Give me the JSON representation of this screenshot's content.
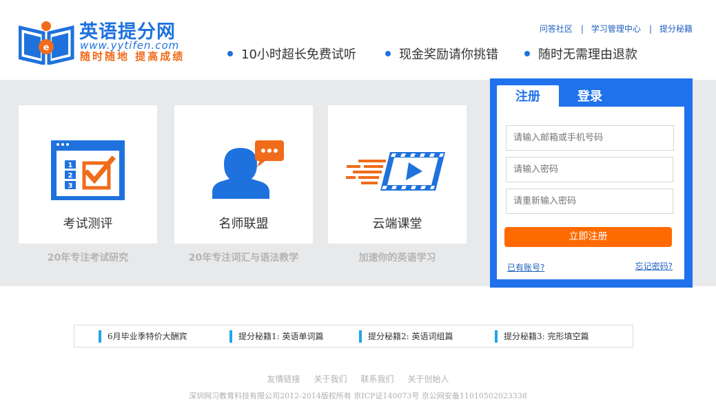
{
  "header": {
    "logo": {
      "title": "英语提分网",
      "url_text": "www.yytifen.com",
      "slogan": "随时随地 提高成绩"
    },
    "features": [
      "10小时超长免费试听",
      "现金奖励请你挑错",
      "随时无需理由退款"
    ],
    "top_links": [
      "问答社区",
      "学习管理中心",
      "提分秘籍"
    ],
    "link_separator": "|"
  },
  "cards": [
    {
      "title": "考试测评",
      "subtitle": "20年专注考试研究",
      "icon": "exam-checklist-icon"
    },
    {
      "title": "名师联盟",
      "subtitle": "20年专注词汇与语法教学",
      "icon": "teacher-chat-icon"
    },
    {
      "title": "云端课堂",
      "subtitle": "加速你的英语学习",
      "icon": "fast-video-icon"
    }
  ],
  "register": {
    "tab_register": "注册",
    "tab_login": "登录",
    "email_placeholder": "请输入邮箱或手机号码",
    "password_placeholder": "请输入密码",
    "confirm_placeholder": "请重新输入密码",
    "submit_label": "立即注册",
    "has_account": "已有账号?",
    "forgot_password": "忘记密码?"
  },
  "news": [
    "6月毕业季特价大酬宾",
    "提分秘籍1: 英语单词篇",
    "提分秘籍2: 英语词组篇",
    "提分秘籍3: 完形填空篇"
  ],
  "footer": {
    "links": [
      "友情链接",
      "关于我们",
      "联系我们",
      "关于创始人"
    ],
    "copyright": "深圳网习教育科技有限公司2012-2014版权所有 京ICP证140073号 京公网安备11010502023338"
  },
  "colors": {
    "brand_blue": "#1f72dd",
    "register_blue": "#1f72eb",
    "accent_orange": "#ff6a00",
    "banner_gray": "#e8e9eb"
  }
}
